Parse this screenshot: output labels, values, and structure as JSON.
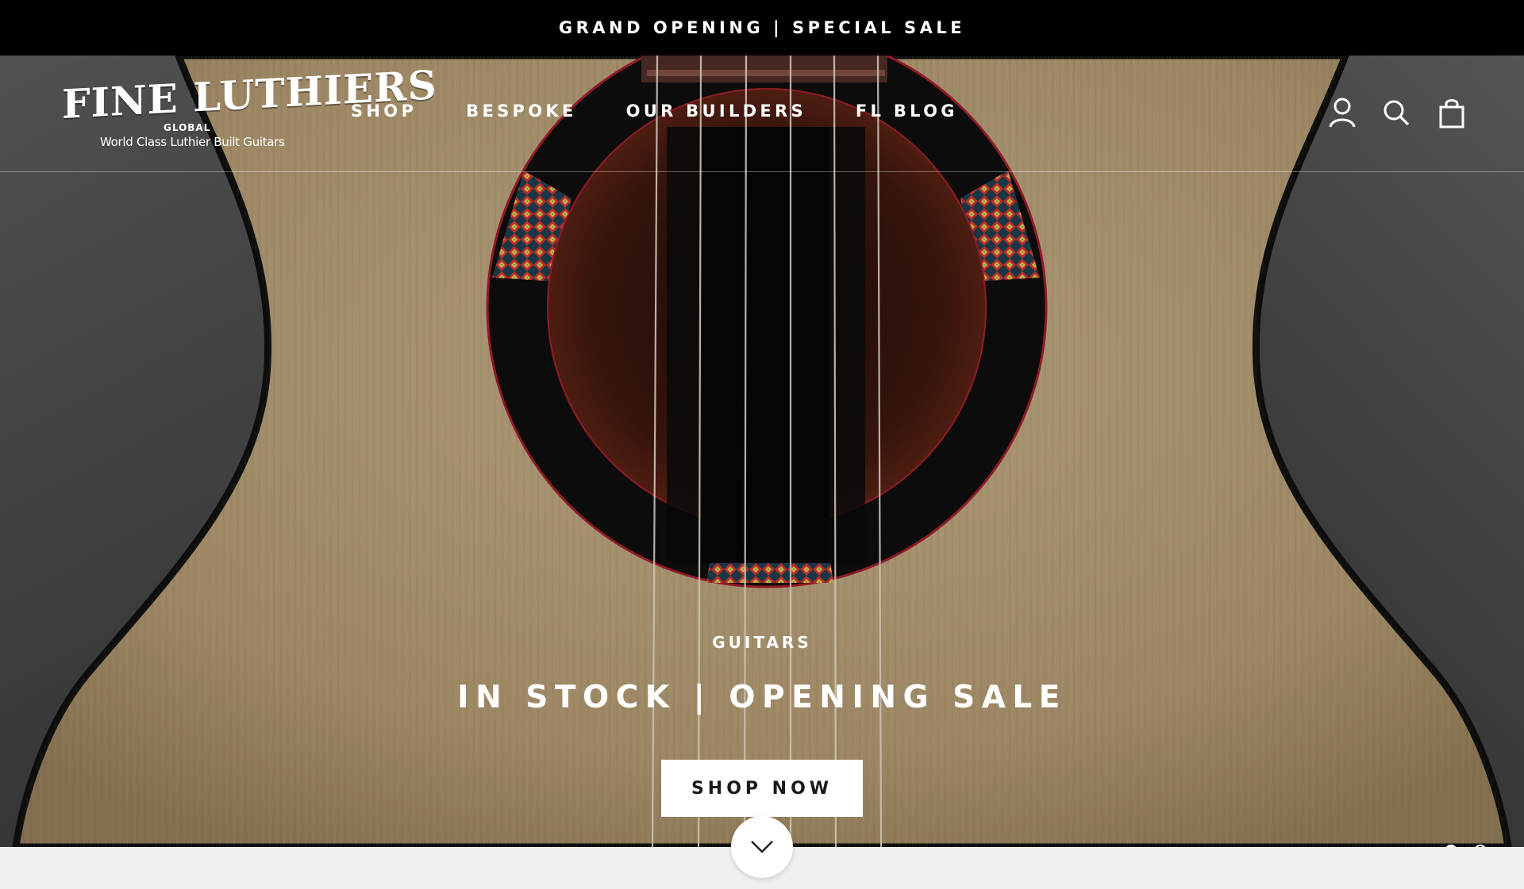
{
  "announcement": {
    "text": "GRAND OPENING | SPECIAL SALE"
  },
  "logo": {
    "wordmark": "FINE LUTHIERS",
    "sub": "GLOBAL",
    "tagline": "World Class Luthier Built Guitars"
  },
  "nav": {
    "items": [
      {
        "label": "SHOP"
      },
      {
        "label": "BESPOKE"
      },
      {
        "label": "OUR BUILDERS"
      },
      {
        "label": "FL BLOG"
      }
    ]
  },
  "header_icons": [
    "account-icon",
    "search-icon",
    "cart-bag-icon"
  ],
  "hero": {
    "eyebrow": "GUITARS",
    "headline": "IN STOCK | OPENING SALE",
    "cta_label": "SHOP NOW",
    "slides_total": 2,
    "active_slide": 1
  },
  "colors": {
    "announcement_bg": "#000000",
    "spruce_top": "#b59f7b",
    "rosette_ring": "#0d0d0d",
    "binding_red": "#9b1c2b",
    "button_bg": "#ffffff",
    "below_fold_bg": "#efefef"
  }
}
